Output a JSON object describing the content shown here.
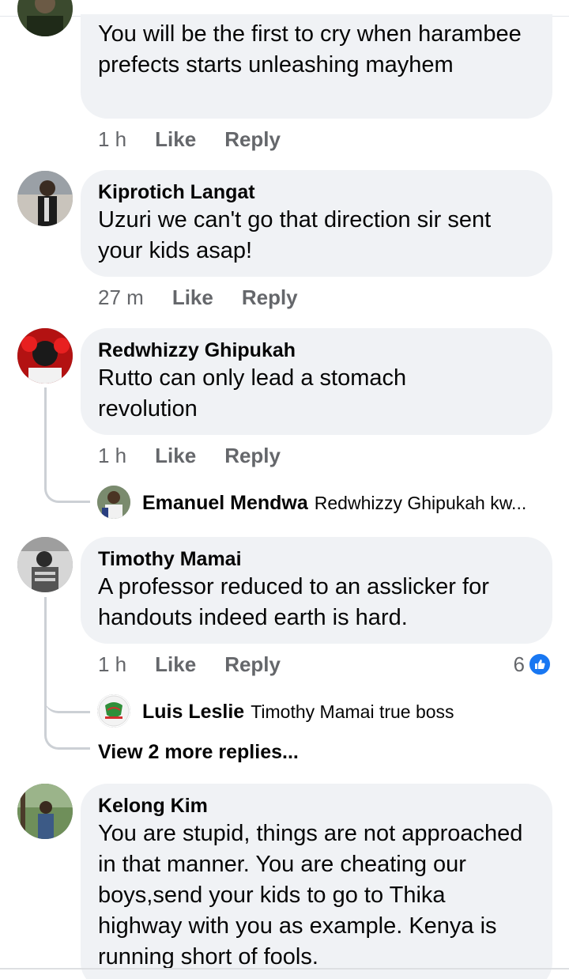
{
  "comments": [
    {
      "text": "You will be the first to cry when harambee prefects starts unleashing mayhem",
      "time": "1 h",
      "like": "Like",
      "reply": "Reply"
    },
    {
      "author": "Kiprotich Langat",
      "text": "Uzuri we can't go that direction sir sent your kids asap!",
      "time": "27 m",
      "like": "Like",
      "reply": "Reply"
    },
    {
      "author": "Redwhizzy Ghipukah",
      "text": "Rutto can only lead a stomach revolution",
      "time": "1 h",
      "like": "Like",
      "reply": "Reply",
      "reply_preview": {
        "author": "Emanuel Mendwa",
        "text": "Redwhizzy Ghipukah kw..."
      }
    },
    {
      "author": "Timothy Mamai",
      "text": "A professor reduced to an asslicker for handouts indeed earth is hard.",
      "time": "1 h",
      "like": "Like",
      "reply": "Reply",
      "reaction_count": "6",
      "reply_preview": {
        "author": "Luis Leslie",
        "text": "Timothy Mamai true boss"
      },
      "view_more": "View 2 more replies..."
    },
    {
      "author": "Kelong Kim",
      "text": "You are stupid, things are not approached in that manner. You are cheating our boys,send your kids to go to Thika highway with you as example. Kenya is running short of fools."
    }
  ],
  "colors": {
    "bubble": "#f0f2f5",
    "meta": "#65676b",
    "like_blue": "#1877f2"
  }
}
